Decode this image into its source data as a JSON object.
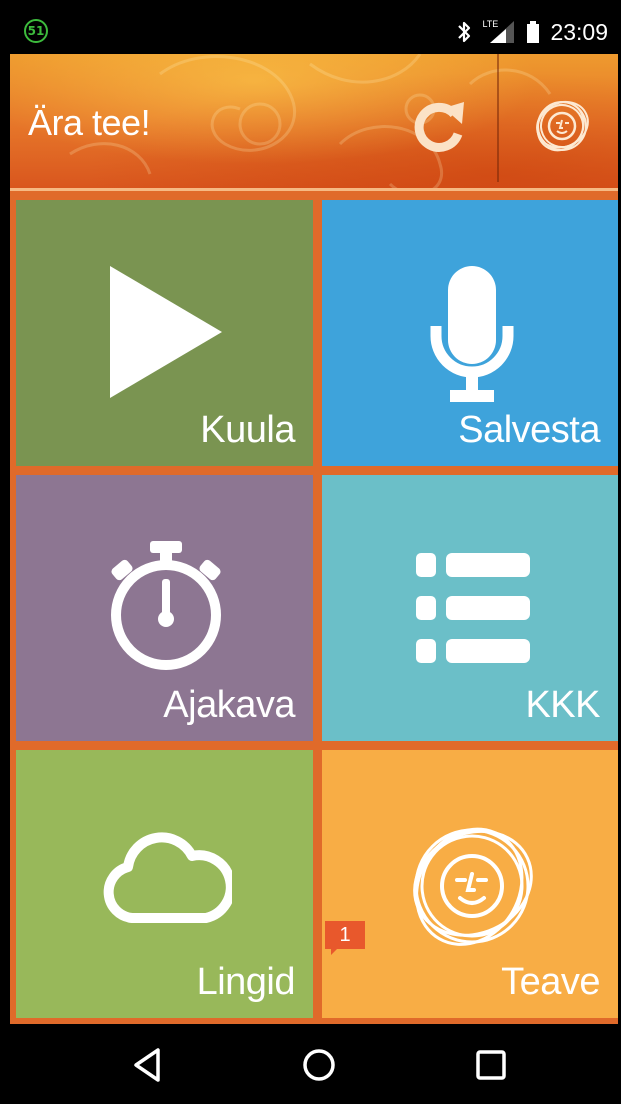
{
  "status_bar": {
    "notification_count": "51",
    "icons": [
      "bluetooth-icon",
      "lte-signal-icon",
      "battery-icon"
    ],
    "network_label": "LTE",
    "time": "23:09"
  },
  "header": {
    "title": "Ära tee!",
    "refresh_icon": "refresh-icon",
    "logo_icon": "smiley-face-logo-icon"
  },
  "tiles": [
    {
      "label": "Kuula",
      "icon": "play-icon",
      "color": "#7a9451"
    },
    {
      "label": "Salvesta",
      "icon": "microphone-icon",
      "color": "#3ea3db"
    },
    {
      "label": "Ajakava",
      "icon": "stopwatch-icon",
      "color": "#8d7692"
    },
    {
      "label": "KKK",
      "icon": "list-icon",
      "color": "#6bbfc8"
    },
    {
      "label": "Lingid",
      "icon": "cloud-icon",
      "color": "#98b85a"
    },
    {
      "label": "Teave",
      "icon": "smiley-face-logo-icon",
      "color": "#f8ad45",
      "badge": "1"
    }
  ],
  "colors": {
    "background": "#e06a2a",
    "header_top": "#ee9a2e",
    "header_bottom": "#d9561e",
    "badge": "#e8582c"
  },
  "nav_bar": {
    "buttons": [
      "back-icon",
      "home-icon",
      "recents-icon"
    ]
  }
}
